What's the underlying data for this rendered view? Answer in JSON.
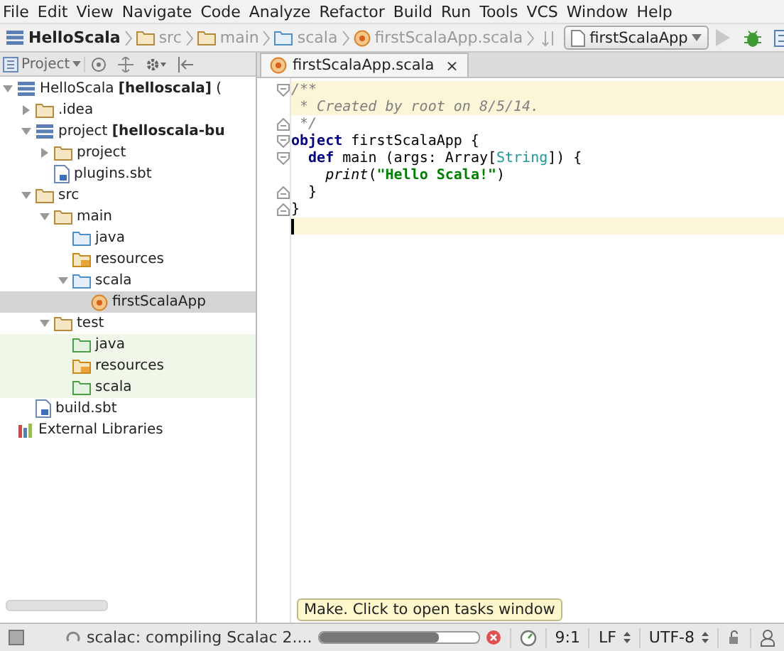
{
  "menu": [
    "File",
    "Edit",
    "View",
    "Navigate",
    "Code",
    "Analyze",
    "Refactor",
    "Build",
    "Run",
    "Tools",
    "VCS",
    "Window",
    "Help"
  ],
  "navbar": {
    "crumbs": [
      {
        "label": "HelloScala",
        "kind": "module"
      },
      {
        "label": "src",
        "kind": "folder"
      },
      {
        "label": "main",
        "kind": "folder"
      },
      {
        "label": "scala",
        "kind": "source"
      },
      {
        "label": "firstScalaApp.scala",
        "kind": "class"
      }
    ],
    "run_config": "firstScalaApp",
    "run_disabled": true
  },
  "tool_window": {
    "title": "Project"
  },
  "tree": [
    {
      "label": "HelloScala **[helloscala]** (",
      "kind": "module",
      "expanded": true,
      "selected": false,
      "test_scope": false,
      "children": [
        {
          "label": ".idea",
          "kind": "folder",
          "expanded": false,
          "selected": false,
          "test_scope": false
        },
        {
          "label": "project **[helloscala-bu**",
          "kind": "module",
          "expanded": true,
          "selected": false,
          "test_scope": false,
          "children": [
            {
              "label": "project",
              "kind": "folder",
              "expanded": false,
              "selected": false,
              "test_scope": false
            },
            {
              "label": "plugins.sbt",
              "kind": "file",
              "selected": false,
              "test_scope": false
            }
          ]
        },
        {
          "label": "src",
          "kind": "folder",
          "expanded": true,
          "selected": false,
          "test_scope": false,
          "children": [
            {
              "label": "main",
              "kind": "folder",
              "expanded": true,
              "selected": false,
              "test_scope": false,
              "children": [
                {
                  "label": "java",
                  "kind": "source",
                  "selected": false,
                  "test_scope": false
                },
                {
                  "label": "resources",
                  "kind": "resources",
                  "selected": false,
                  "test_scope": false
                },
                {
                  "label": "scala",
                  "kind": "source",
                  "expanded": true,
                  "selected": false,
                  "test_scope": false,
                  "children": [
                    {
                      "label": "firstScalaApp",
                      "kind": "class",
                      "selected": true,
                      "test_scope": false
                    }
                  ]
                }
              ]
            },
            {
              "label": "test",
              "kind": "folder",
              "expanded": true,
              "selected": false,
              "test_scope": false,
              "children": [
                {
                  "label": "java",
                  "kind": "test",
                  "selected": false,
                  "test_scope": true
                },
                {
                  "label": "resources",
                  "kind": "resources",
                  "selected": false,
                  "test_scope": true
                },
                {
                  "label": "scala",
                  "kind": "test",
                  "selected": false,
                  "test_scope": true
                }
              ]
            }
          ]
        },
        {
          "label": "build.sbt",
          "kind": "file",
          "selected": false,
          "test_scope": false
        }
      ]
    },
    {
      "label": "External Libraries",
      "kind": "libraries",
      "selected": false,
      "test_scope": false
    }
  ],
  "editor_tab": {
    "label": "firstScalaApp.scala",
    "close": "×"
  },
  "code": [
    {
      "kind": "fold_start",
      "highlighted": true,
      "caret": false,
      "tokens": [
        {
          "kind": "comment",
          "text": "/**"
        }
      ]
    },
    {
      "kind": "plain",
      "highlighted": true,
      "caret": false,
      "tokens": [
        {
          "kind": "comment",
          "text": " * Created by root on 8/5/14."
        }
      ]
    },
    {
      "kind": "fold_end",
      "highlighted": false,
      "caret": false,
      "tokens": [
        {
          "kind": "comment",
          "text": " */"
        }
      ]
    },
    {
      "kind": "fold_start",
      "highlighted": false,
      "caret": false,
      "tokens": [
        {
          "kind": "keyword",
          "text": "object"
        },
        {
          "kind": "plain",
          "text": " firstScalaApp {"
        }
      ]
    },
    {
      "kind": "fold_start",
      "highlighted": false,
      "caret": false,
      "tokens": [
        {
          "kind": "keyword",
          "text": "  def"
        },
        {
          "kind": "plain",
          "text": " main (args: Array["
        },
        {
          "kind": "type",
          "text": "String"
        },
        {
          "kind": "plain",
          "text": "]) {"
        }
      ]
    },
    {
      "kind": "plain",
      "highlighted": false,
      "caret": false,
      "tokens": [
        {
          "kind": "method",
          "text": "    print"
        },
        {
          "kind": "plain",
          "text": "("
        },
        {
          "kind": "string",
          "text": "\"Hello Scala!\""
        },
        {
          "kind": "plain",
          "text": ")"
        }
      ]
    },
    {
      "kind": "fold_end",
      "highlighted": false,
      "caret": false,
      "tokens": [
        {
          "kind": "plain",
          "text": "  }"
        }
      ]
    },
    {
      "kind": "fold_end",
      "highlighted": false,
      "caret": false,
      "tokens": [
        {
          "kind": "plain",
          "text": "}"
        }
      ]
    },
    {
      "kind": "plain",
      "highlighted": true,
      "caret": true
    }
  ],
  "tooltip": "Make. Click to open tasks window",
  "status_bar": {
    "task": "scalac: compiling Scalac 2....",
    "level": 0.75,
    "position": "9:1",
    "line_separator": "LF",
    "encoding": "UTF-8"
  }
}
